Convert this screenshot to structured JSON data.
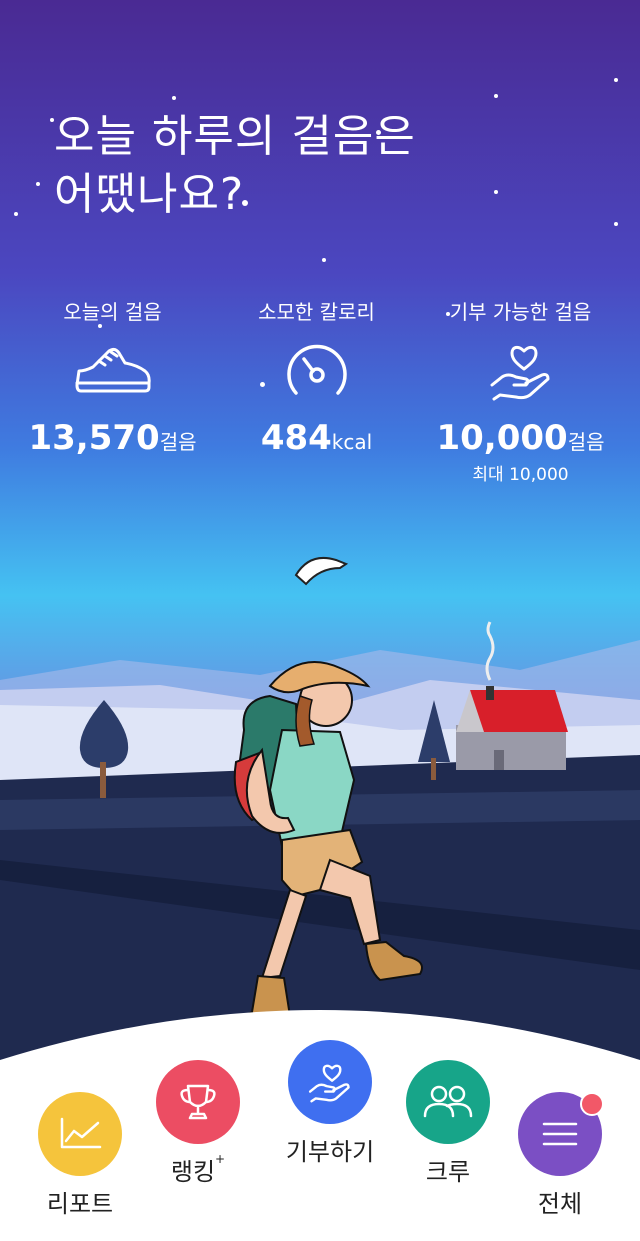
{
  "headline": {
    "line1": "오늘 하루의 걸음은",
    "line2": "어땠나요?"
  },
  "stats": [
    {
      "label": "오늘의 걸음",
      "icon": "sneaker-icon",
      "value": "13,570",
      "unit": "걸음"
    },
    {
      "label": "소모한 칼로리",
      "icon": "gauge-icon",
      "value": "484",
      "unit": "kcal"
    },
    {
      "label": "기부 가능한 걸음",
      "icon": "heart-hand-icon",
      "value": "10,000",
      "unit": "걸음",
      "sub": "최대 10,000"
    }
  ],
  "nav": {
    "report": {
      "label": "리포트",
      "icon": "chart-icon",
      "color": "#f5c43c"
    },
    "ranking": {
      "label": "랭킹",
      "sup": "+",
      "icon": "trophy-icon",
      "color": "#ec4d63"
    },
    "donate": {
      "label": "기부하기",
      "icon": "heart-hand-icon",
      "color": "#3f6ff0"
    },
    "crew": {
      "label": "크루",
      "icon": "people-icon",
      "color": "#17a589"
    },
    "all": {
      "label": "전체",
      "icon": "menu-icon",
      "color": "#7b4fc4",
      "badge_color": "#f25868"
    }
  }
}
